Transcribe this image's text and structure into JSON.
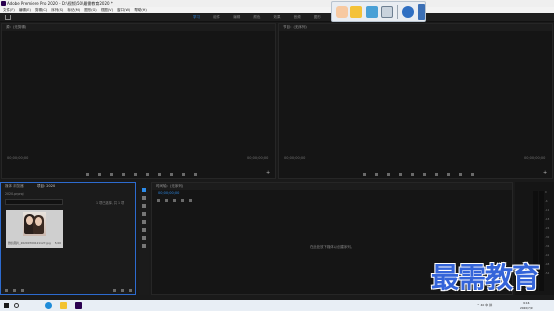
{
  "window": {
    "title": "Adobe Premiere Pro 2020 - D:\\视频\\50\\最需教育2020 *"
  },
  "menu": [
    "文件(F)",
    "编辑(E)",
    "剪辑(C)",
    "序列(S)",
    "标记(M)",
    "图形(G)",
    "视图(V)",
    "窗口(W)",
    "帮助(H)"
  ],
  "workspace_tabs": [
    "学习",
    "组件",
    "编辑",
    "颜色",
    "效果",
    "音频",
    "图形",
    "库"
  ],
  "floating_toolbar": {
    "icons": [
      "hand-icon",
      "note-icon",
      "image-icon",
      "zoom-icon",
      "info-icon",
      "collapse-icon"
    ]
  },
  "source_monitor": {
    "title": "源：(无剪辑)",
    "timecode_left": "00;00;00;00",
    "timecode_right": "00;00;00;00"
  },
  "program_monitor": {
    "title": "节目：(无序列)",
    "timecode_left": "00;00;00;00",
    "timecode_right": "00;00;00;00"
  },
  "project_panel": {
    "tabs": [
      "媒体 浏览器",
      "项目: 2020"
    ],
    "subtitle": "2020.prproj",
    "item_count": "1 项已选择, 共 1 项",
    "clip": {
      "name": "微信图片_20200709121127.jpg",
      "duration": "5;00"
    }
  },
  "timeline": {
    "title": "时间轴：(无序列)",
    "timecode": "00;00;00;00",
    "empty_message": "在此处放下媒体以创建序列。"
  },
  "audio_meter": {
    "scale": [
      "0",
      "-6",
      "-12",
      "-18",
      "-24",
      "-30",
      "-36",
      "-42",
      "-48",
      "-54"
    ]
  },
  "watermark": {
    "text": "最需教育"
  },
  "taskbar": {
    "tray_text": "^ 40 中 拼",
    "time": "9:16",
    "date": "2020/7/9"
  }
}
